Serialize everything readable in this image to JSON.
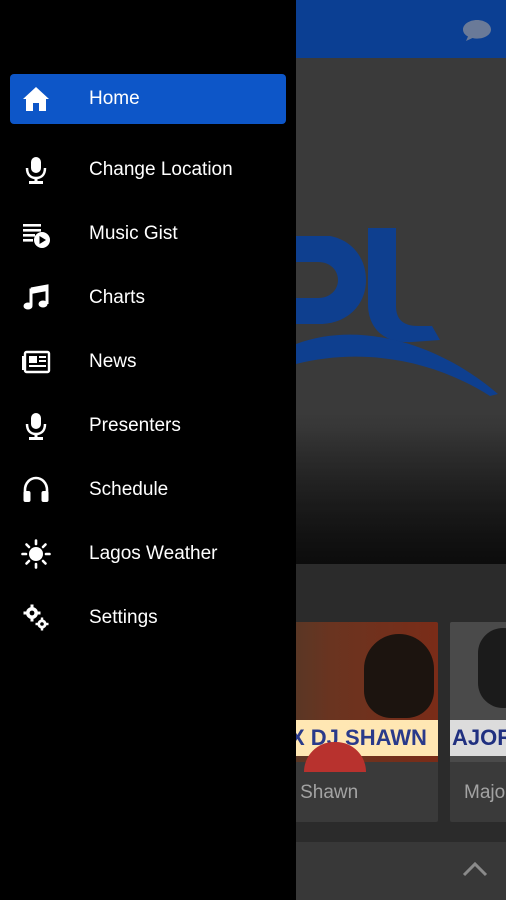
{
  "colors": {
    "accent": "#0d56c8",
    "topbar": "#0b3f93",
    "drawer_bg": "#000000"
  },
  "drawer": {
    "items": [
      {
        "label": "Home",
        "icon": "home-icon",
        "active": true
      },
      {
        "label": "Change Location",
        "icon": "microphone-icon",
        "active": false
      },
      {
        "label": "Music Gist",
        "icon": "playlist-play-icon",
        "active": false
      },
      {
        "label": "Charts",
        "icon": "music-note-icon",
        "active": false
      },
      {
        "label": "News",
        "icon": "newspaper-icon",
        "active": false
      },
      {
        "label": "Presenters",
        "icon": "microphone-icon",
        "active": false
      },
      {
        "label": "Schedule",
        "icon": "headphones-icon",
        "active": false
      },
      {
        "label": "Lagos Weather",
        "icon": "sun-icon",
        "active": false
      },
      {
        "label": "Settings",
        "icon": "gears-icon",
        "active": false
      }
    ]
  },
  "background": {
    "cards": [
      {
        "banner": "X DJ SHAWN",
        "caption": "- DJ Shawn"
      },
      {
        "banner": "AJOR",
        "caption": "Majo"
      }
    ]
  }
}
